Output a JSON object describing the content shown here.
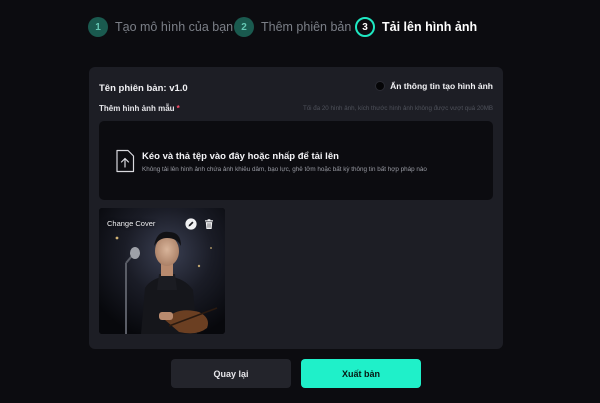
{
  "stepper": {
    "steps": [
      {
        "number": "1",
        "label": "Tạo mô hình của bạn",
        "state": "done"
      },
      {
        "number": "2",
        "label": "Thêm phiên bản",
        "state": "done"
      },
      {
        "number": "3",
        "label": "Tải lên hình ảnh",
        "state": "active"
      }
    ]
  },
  "panel": {
    "version_label": "Tên phiên bản: v1.0",
    "hide_info_toggle": {
      "label": "Ẩn thông tin tạo hình ảnh",
      "checked": false
    },
    "add_images_label": "Thêm hình ảnh mẫu",
    "required_mark": "*",
    "limit_hint": "Tối đa 20 hình ảnh, kích thước hình ảnh không được vượt quá 20MB",
    "dropzone": {
      "icon": "upload-file-icon",
      "title": "Kéo và thả tệp vào đây hoặc nhấp để tải lên",
      "subtitle": "Không tải lên hình ảnh chứa ảnh khiêu dâm, bạo lực, ghê tởm hoặc bất kỳ thông tin bất hợp pháp nào"
    },
    "thumbnail": {
      "change_cover_label": "Change Cover",
      "edit_icon": "pencil-icon",
      "delete_icon": "trash-icon"
    }
  },
  "footer": {
    "back_label": "Quay lại",
    "publish_label": "Xuất bản"
  },
  "colors": {
    "accent": "#1ff0c9",
    "background": "#0c0c10",
    "panel": "#1d1e25",
    "required": "#ff4d6a"
  }
}
